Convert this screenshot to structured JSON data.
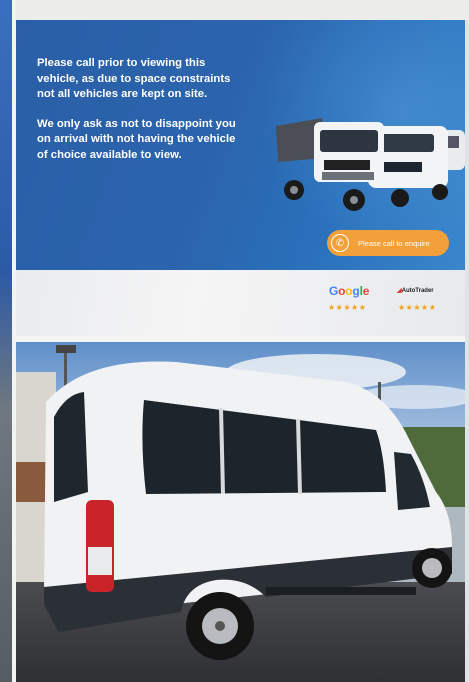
{
  "banner": {
    "paragraph1": "Please call prior to viewing this vehicle, as due to space constraints not all vehicles are kept on site.",
    "paragraph2": "We only ask as not to disappoint you on arrival with not having the vehicle of choice available to view.",
    "cta_label": "Please call to enquire"
  },
  "reviews": {
    "google_label": "Google",
    "google_stars": "★★★★★",
    "autotrader_label": "AutoTrader",
    "autotrader_stars": "★★★★★"
  },
  "colors": {
    "banner_blue": "#2b64ad",
    "cta_orange": "#f2a13a",
    "star_gold": "#f0a21a"
  },
  "icons": [
    "phone-icon"
  ]
}
